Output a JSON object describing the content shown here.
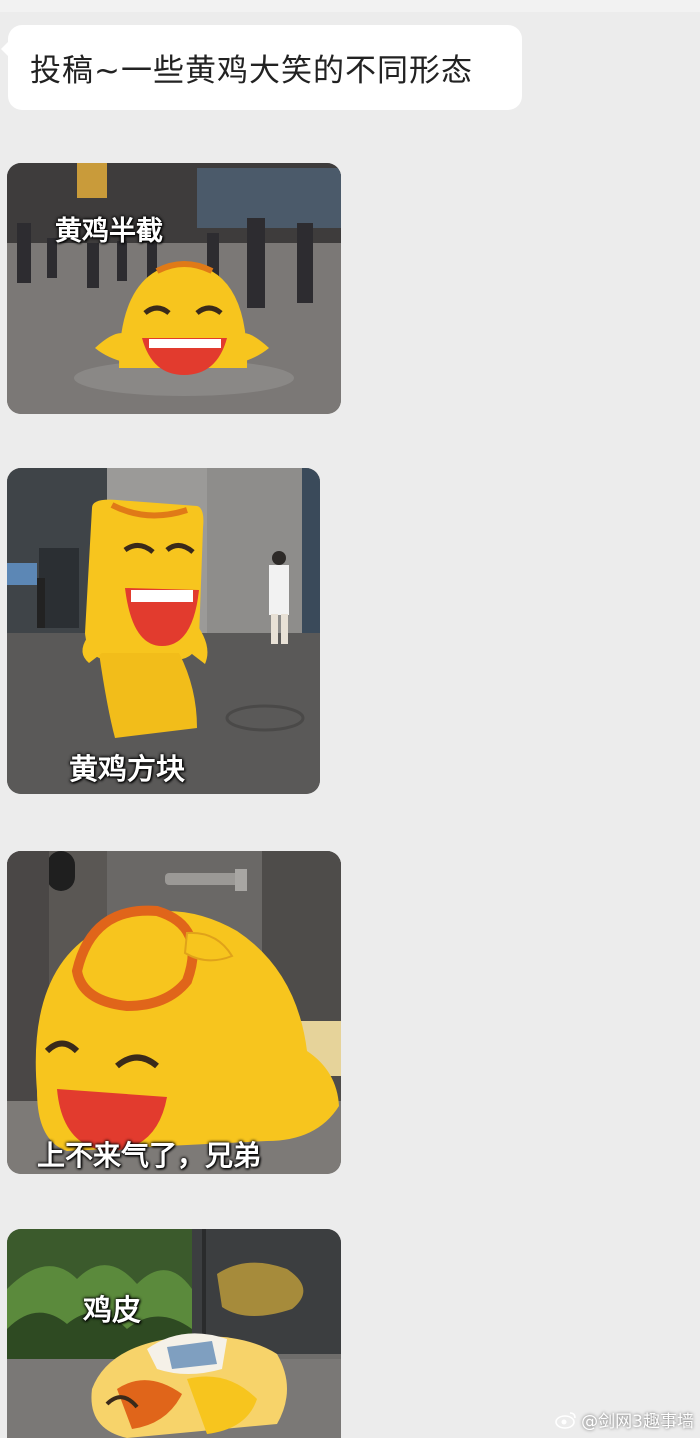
{
  "message": {
    "text": "投稿~一些黄鸡大笑的不同形态"
  },
  "photos": [
    {
      "caption": "黄鸡半截"
    },
    {
      "caption": "黄鸡方块"
    },
    {
      "caption": "上不来气了，兄弟"
    },
    {
      "caption": "鸡皮"
    }
  ],
  "watermark": {
    "text": "@剑网3趣事墙",
    "icon": "weibo-icon"
  },
  "colors": {
    "background": "#ececec",
    "bubble": "#ffffff",
    "mascot_yellow": "#f7c51e",
    "mouth_red": "#e23b2e"
  }
}
